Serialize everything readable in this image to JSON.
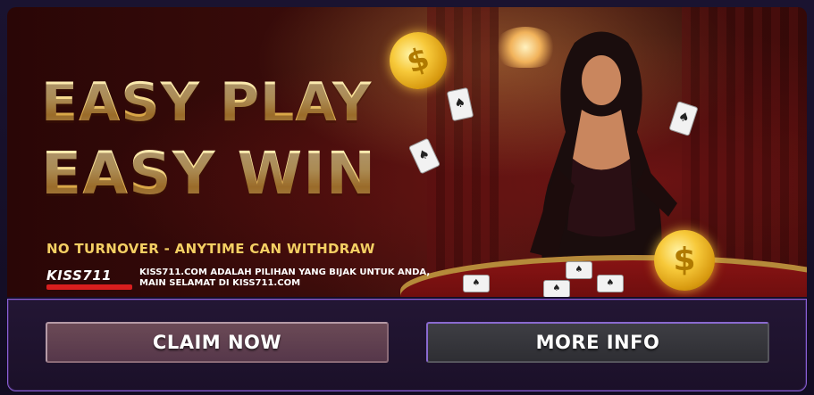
{
  "banner": {
    "headline_line1": "EASY PLAY",
    "headline_line2": "EASY WIN",
    "tagline": "NO TURNOVER - ANYTIME CAN WITHDRAW",
    "logo_text": "KISS711",
    "promo_line1": "KISS711.COM ADALAH PILIHAN YANG BIJAK UNTUK ANDA,",
    "promo_line2": "MAIN SELAMAT DI KISS711.COM",
    "coin_symbol": "$",
    "card_symbol": "♠"
  },
  "actions": {
    "claim_label": "CLAIM NOW",
    "more_info_label": "MORE INFO"
  },
  "colors": {
    "gold": "#f4cf63",
    "logo_red": "#d81e1e",
    "panel_border": "#8b5fd6"
  }
}
